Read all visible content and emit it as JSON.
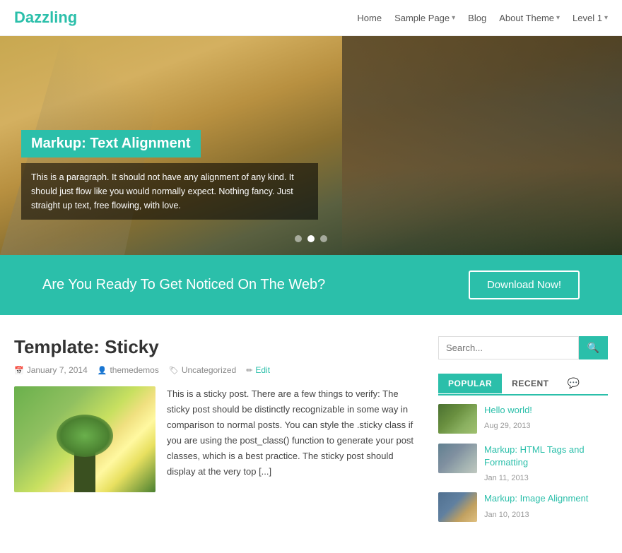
{
  "header": {
    "logo": "Dazzling",
    "nav": [
      {
        "label": "Home",
        "has_dropdown": false
      },
      {
        "label": "Sample Page",
        "has_dropdown": true
      },
      {
        "label": "Blog",
        "has_dropdown": false
      },
      {
        "label": "About Theme",
        "has_dropdown": true
      },
      {
        "label": "Level 1",
        "has_dropdown": true
      }
    ]
  },
  "hero": {
    "title": "Markup: Text Alignment",
    "description": "This is a paragraph. It should not have any alignment of any kind. It should just flow like you would normally expect. Nothing fancy. Just straight up text, free flowing, with love.",
    "dots": [
      1,
      2,
      3
    ],
    "active_dot": 2
  },
  "cta": {
    "text": "Are You Ready To Get Noticed On The Web?",
    "button_label": "Download Now!"
  },
  "post": {
    "title": "Template: Sticky",
    "date": "January 7, 2014",
    "author": "themedemos",
    "category": "Uncategorized",
    "edit_label": "Edit",
    "excerpt": "This is a sticky post. There are a few things to verify: The sticky post should be distinctly recognizable in some way in comparison to normal posts. You can style the .sticky class if you are using the post_class() function to generate your post classes, which is a best practice. The sticky post should display at the very top [...]"
  },
  "sidebar": {
    "search_placeholder": "Search...",
    "tabs": [
      {
        "label": "POPULAR",
        "active": true
      },
      {
        "label": "RECENT",
        "active": false
      }
    ],
    "popular_posts": [
      {
        "title": "Hello world!",
        "date": "Aug 29, 2013",
        "thumb_class": "thumb1"
      },
      {
        "title": "Markup: HTML Tags and Formatting",
        "date": "Jan 11, 2013",
        "thumb_class": "thumb2"
      },
      {
        "title": "Markup: Image Alignment",
        "date": "Jan 10, 2013",
        "thumb_class": "thumb3"
      }
    ]
  },
  "colors": {
    "accent": "#2bbfaa",
    "text_muted": "#888",
    "link": "#2bbfaa"
  }
}
